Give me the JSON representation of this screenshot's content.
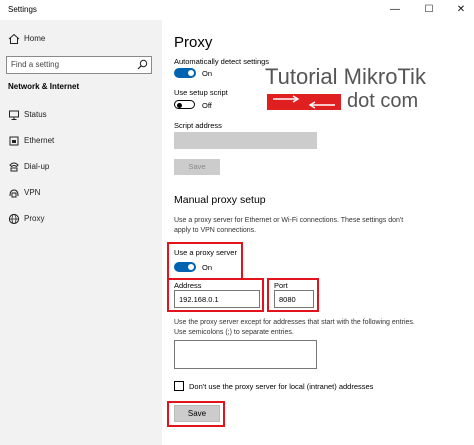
{
  "window": {
    "title": "Settings",
    "minimize": "—",
    "maximize": "☐",
    "close": "✕"
  },
  "sidebar": {
    "home_label": "Home",
    "search_placeholder": "Find a setting",
    "section_title": "Network & Internet",
    "items": [
      {
        "label": "Status",
        "icon": "status-icon"
      },
      {
        "label": "Ethernet",
        "icon": "ethernet-icon"
      },
      {
        "label": "Dial-up",
        "icon": "dialup-icon"
      },
      {
        "label": "VPN",
        "icon": "vpn-icon"
      },
      {
        "label": "Proxy",
        "icon": "globe-icon"
      }
    ]
  },
  "main": {
    "title": "Proxy",
    "auto_detect": {
      "label": "Automatically detect settings",
      "state": "On"
    },
    "setup_script": {
      "label": "Use setup script",
      "state": "Off"
    },
    "script_address_label": "Script address",
    "script_save_label": "Save",
    "manual_heading": "Manual proxy setup",
    "manual_desc": "Use a proxy server for Ethernet or Wi-Fi connections. These settings don't apply to VPN connections.",
    "use_proxy": {
      "label": "Use a proxy server",
      "state": "On"
    },
    "address_label": "Address",
    "address_value": "192.168.0.1",
    "port_label": "Port",
    "port_value": "8080",
    "exceptions_desc": "Use the proxy server except for addresses that start with the following entries. Use semicolons (;) to separate entries.",
    "local_checkbox_label": "Don't use the proxy server for local (intranet) addresses",
    "save_label": "Save"
  },
  "watermark": {
    "line1": "Tutorial MikroTik",
    "line2": "dot com"
  },
  "colors": {
    "accent": "#0063b1",
    "highlight": "#e3131b",
    "sidebar_bg": "#f2f2f2",
    "disabled": "#cccccc"
  }
}
